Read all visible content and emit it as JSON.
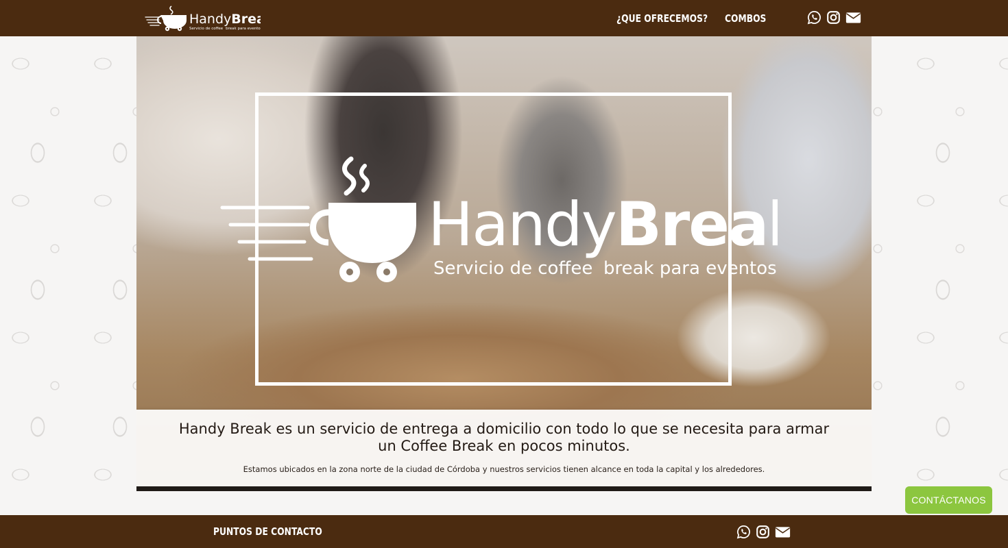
{
  "brand": {
    "name_part1": "Handy",
    "name_part2": "Break",
    "tagline_left": "Servicio de coffee",
    "tagline_right": "break para eventos"
  },
  "nav": {
    "items": [
      {
        "label": "¿QUE OFRECEMOS?"
      },
      {
        "label": "COMBOS"
      }
    ]
  },
  "social": {
    "icons": [
      "whatsapp-icon",
      "instagram-icon",
      "mail-icon"
    ]
  },
  "hero": {
    "main_text": "Handy Break es un servicio de entrega a domicilio con todo lo que se necesita para armar un Coffee Break en pocos minutos.",
    "sub_text": "Estamos ubicados en la zona norte de la ciudad de Córdoba y nuestros servicios tienen alcance en toda la capital y los alrededores."
  },
  "footer": {
    "title": "Puntos de contacto"
  },
  "contact_button": {
    "label": "CONTÁCTANOS"
  },
  "colors": {
    "brand_brown": "#4b2b10",
    "accent_green": "#8cc63f",
    "white": "#ffffff"
  }
}
